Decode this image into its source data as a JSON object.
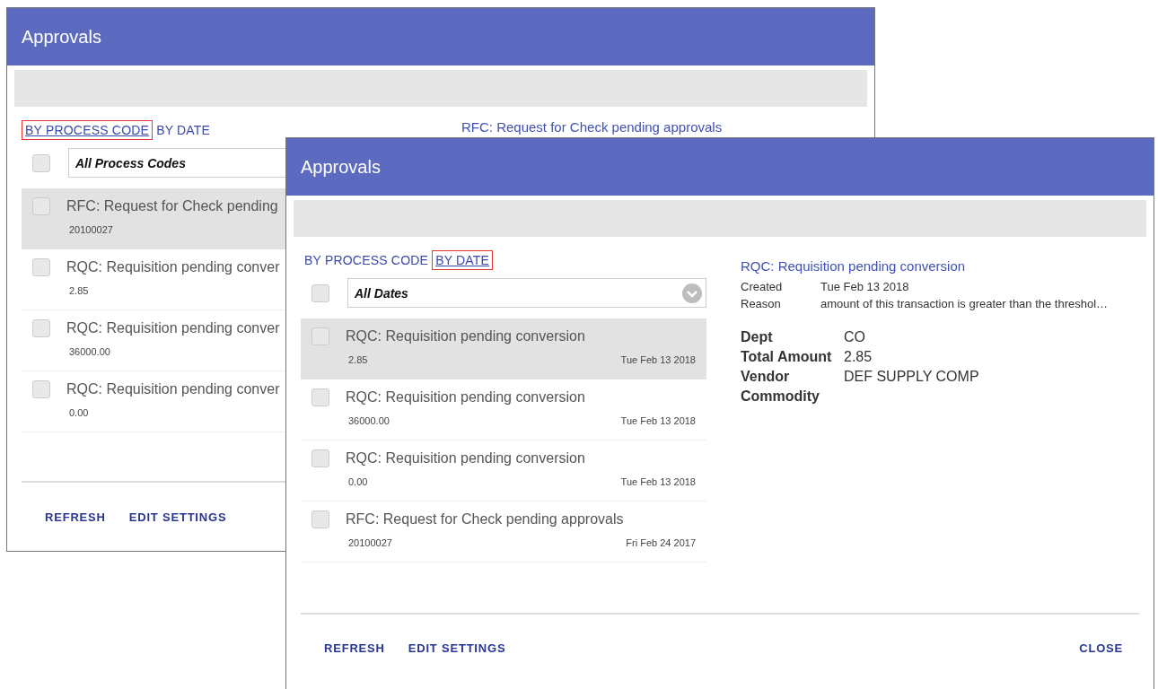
{
  "windows": [
    {
      "title": "Approvals",
      "tabs": [
        {
          "label": "BY PROCESS CODE",
          "selected": true
        },
        {
          "label": "BY DATE",
          "selected": false
        }
      ],
      "filter": {
        "value": "All Process Codes",
        "checked": false
      },
      "items": [
        {
          "title": "RFC: Request for Check pending",
          "amount": "20100027",
          "selected": true,
          "checked": false
        },
        {
          "title": "RQC: Requisition pending conver",
          "amount": "2.85",
          "selected": false,
          "checked": false
        },
        {
          "title": "RQC: Requisition pending conver",
          "amount": "36000.00",
          "selected": false,
          "checked": false
        },
        {
          "title": "RQC: Requisition pending conver",
          "amount": "0.00",
          "selected": false,
          "checked": false
        }
      ],
      "detail": {
        "heading": "RFC: Request for Check pending approvals"
      },
      "buttons": [
        "REFRESH",
        "EDIT SETTINGS"
      ]
    },
    {
      "title": "Approvals",
      "tabs": [
        {
          "label": "BY PROCESS CODE",
          "selected": false
        },
        {
          "label": "BY DATE",
          "selected": true
        }
      ],
      "filter": {
        "value": "All Dates",
        "checked": false
      },
      "items": [
        {
          "title": "RQC: Requisition pending conversion",
          "amount": "2.85",
          "date": "Tue Feb 13 2018",
          "selected": true,
          "checked": false
        },
        {
          "title": "RQC: Requisition pending conversion",
          "amount": "36000.00",
          "date": "Tue Feb 13 2018",
          "selected": false,
          "checked": false
        },
        {
          "title": "RQC: Requisition pending conversion",
          "amount": "0.00",
          "date": "Tue Feb 13 2018",
          "selected": false,
          "checked": false
        },
        {
          "title": "RFC: Request for Check pending approvals",
          "amount": "20100027",
          "date": "Fri Feb 24 2017",
          "selected": false,
          "checked": false
        }
      ],
      "detail": {
        "heading": "RQC: Requisition pending conversion",
        "meta": [
          {
            "label": "Created",
            "value": "Tue Feb 13 2018"
          },
          {
            "label": "Reason",
            "value": "amount of this transaction is greater than the threshol…"
          }
        ],
        "fields": [
          {
            "label": "Dept",
            "value": "CO"
          },
          {
            "label": "Total Amount",
            "value": "2.85"
          },
          {
            "label": "Vendor",
            "value": "DEF SUPPLY COMP"
          },
          {
            "label": "Commodity"
          }
        ]
      },
      "buttons": [
        "REFRESH",
        "EDIT SETTINGS"
      ],
      "close": "CLOSE"
    }
  ]
}
